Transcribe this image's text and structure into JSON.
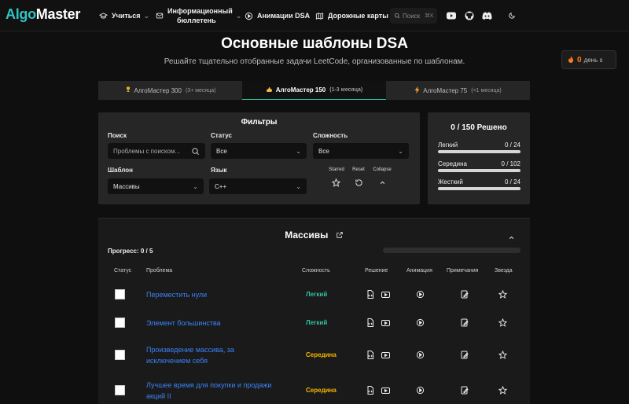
{
  "header": {
    "logo_part1": "Algo",
    "logo_part2": "Master",
    "nav": {
      "learn": "Учиться",
      "newsletter_line1": "Информационный",
      "newsletter_line2": "бюллетень",
      "animations": "Анимации DSA",
      "roadmaps": "Дорожные карты"
    },
    "search_placeholder": "Поиск",
    "search_shortcut": "⌘K"
  },
  "streak": {
    "count": "0",
    "unit": "день s"
  },
  "hero": {
    "title": "Основные шаблоны DSA",
    "subtitle": "Решайте тщательно отобранные задачи LeetCode, организованные по шаблонам."
  },
  "tabs": [
    {
      "label": "АлгоМастер 300",
      "sub": "(3+ месяца)",
      "icon": "trophy-icon"
    },
    {
      "label": "АлгоМастер 150",
      "sub": "(1-3 месяца)",
      "icon": "flex-arm-icon"
    },
    {
      "label": "АлгоМастер 75",
      "sub": "(<1 месяца)",
      "icon": "lightning-icon"
    }
  ],
  "filters": {
    "title": "Фильтры",
    "search_label": "Поиск",
    "search_placeholder": "Проблемы с поиском...",
    "status_label": "Статус",
    "status_value": "Все",
    "difficulty_label": "Сложность",
    "difficulty_value": "Все",
    "pattern_label": "Шаблон",
    "pattern_value": "Массивы",
    "language_label": "Язык",
    "language_value": "C++",
    "starred_label": "Starred",
    "reset_label": "Reset",
    "collapse_label": "Collapse"
  },
  "solved": {
    "title": "0 / 150 Решено",
    "rows": [
      {
        "label": "Легкий",
        "count": "0 / 24"
      },
      {
        "label": "Середина",
        "count": "0 / 102"
      },
      {
        "label": "Жесткий",
        "count": "0 / 24"
      }
    ]
  },
  "section": {
    "title": "Массивы",
    "progress": "Прогресс: 0 / 5",
    "progress_fraction": 0,
    "columns": {
      "status": "Статус",
      "problem": "Проблема",
      "difficulty": "Сложность",
      "solution": "Решение",
      "animation": "Анимация",
      "notes": "Примечания",
      "star": "Звезда"
    },
    "rows": [
      {
        "line1": "Переместить нули",
        "line2": "",
        "difficulty": "Легкий",
        "level": "easy"
      },
      {
        "line1": "Элемент большинства",
        "line2": "",
        "difficulty": "Легкий",
        "level": "easy"
      },
      {
        "line1": "Произведение массива, за",
        "line2": "исключением себя",
        "difficulty": "Середина",
        "level": "medium"
      },
      {
        "line1": "Лучшее время для покупки и продажи",
        "line2": "акций II",
        "difficulty": "Середина",
        "level": "medium"
      }
    ]
  }
}
